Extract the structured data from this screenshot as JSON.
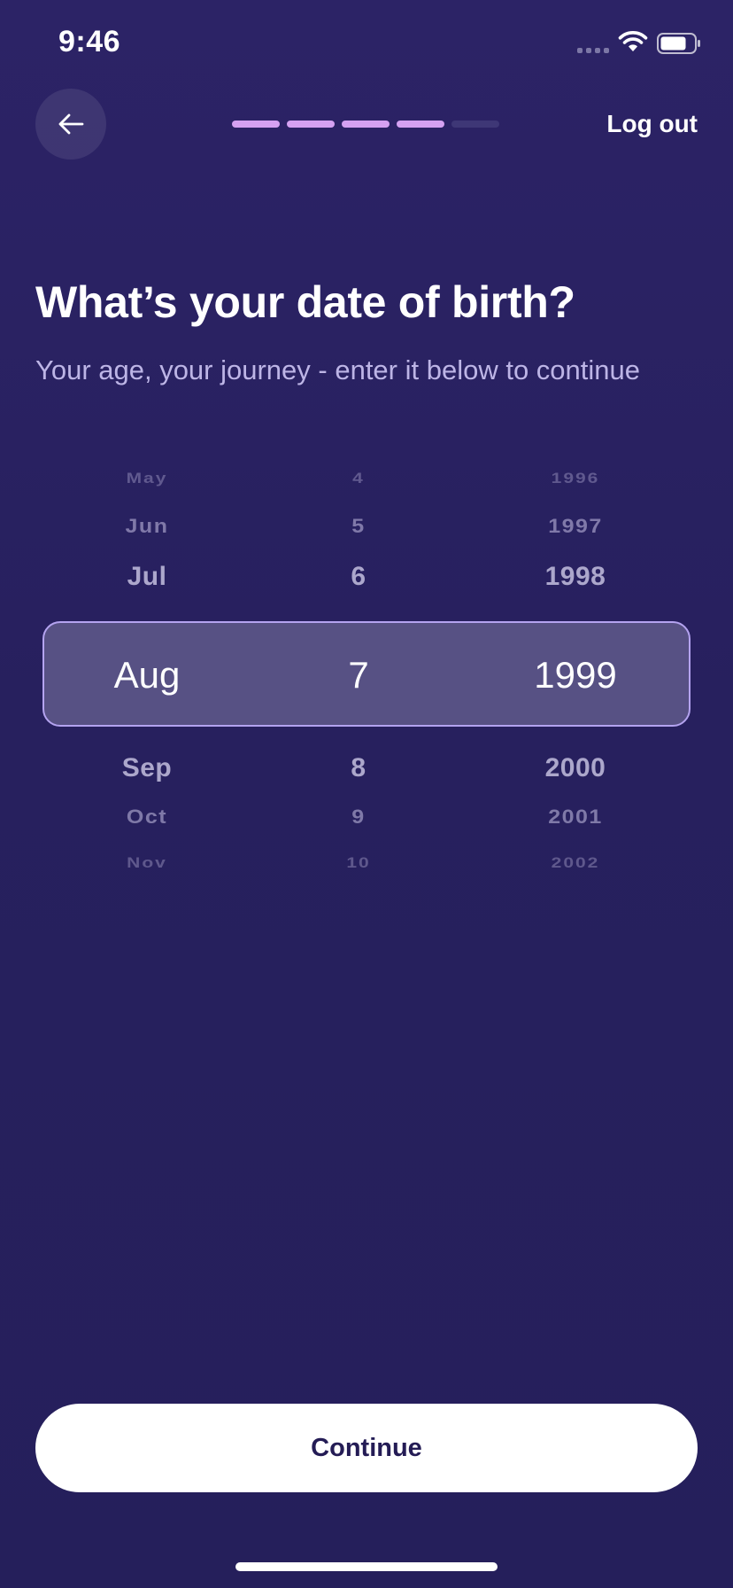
{
  "status_bar": {
    "time": "9:46"
  },
  "header": {
    "back_icon": "arrow-left-icon",
    "progress_total": 5,
    "progress_completed": 4,
    "logout_label": "Log out"
  },
  "content": {
    "title": "What’s your date of birth?",
    "subtitle": "Your age, your journey - enter it below to continue"
  },
  "picker": {
    "months": [
      "May",
      "Jun",
      "Jul",
      "Aug",
      "Sep",
      "Oct",
      "Nov"
    ],
    "days": [
      "4",
      "5",
      "6",
      "7",
      "8",
      "9",
      "10"
    ],
    "years": [
      "1996",
      "1997",
      "1998",
      "1999",
      "2000",
      "2001",
      "2002"
    ],
    "selected": {
      "month": "Aug",
      "day": "7",
      "year": "1999"
    }
  },
  "footer": {
    "continue_label": "Continue"
  },
  "colors": {
    "background": "#2a2262",
    "progress_done": "#d5a1f2",
    "progress_todo": "#3e3776",
    "highlight": "#575184",
    "highlight_border": "#b4a3f0",
    "subtitle": "#bdb5e6"
  }
}
